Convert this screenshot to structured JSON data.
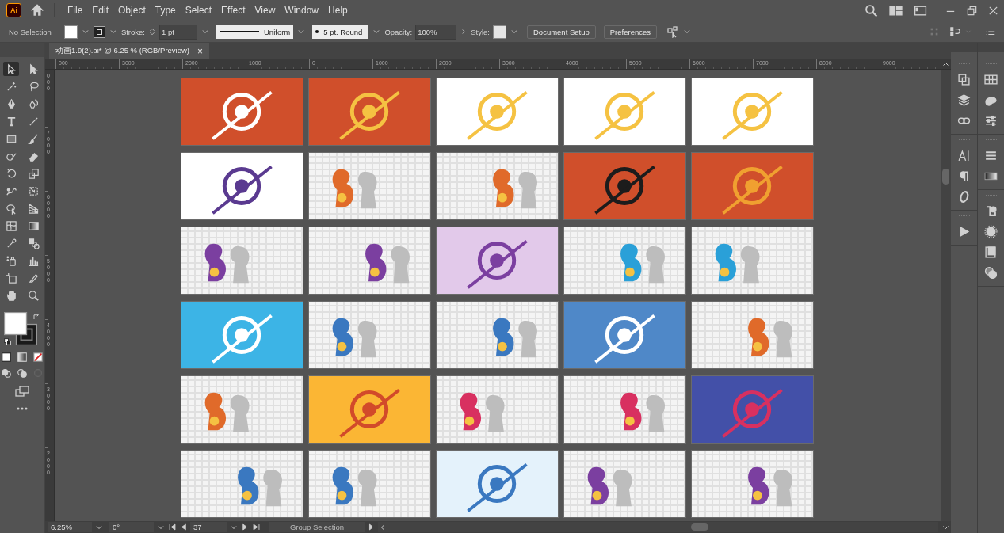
{
  "app_icon": "Ai",
  "menu": [
    "File",
    "Edit",
    "Object",
    "Type",
    "Select",
    "Effect",
    "View",
    "Window",
    "Help"
  ],
  "control_bar": {
    "selection": "No Selection",
    "stroke_label": "Stroke:",
    "stroke_weight": "1 pt",
    "profile": "Uniform",
    "brush": "5 pt. Round",
    "opacity_label": "Opacity:",
    "opacity": "100%",
    "style_label": "Style:",
    "buttons": [
      "Document Setup",
      "Preferences"
    ]
  },
  "document_tab": {
    "title": "动画1.9(2).ai* @ 6.25 % (RGB/Preview)",
    "close": "×"
  },
  "ruler_h": [
    "000",
    "3000",
    "2000",
    "1000",
    "0",
    "1000",
    "2000",
    "3000",
    "4000",
    "5000",
    "6000",
    "7000",
    "8000",
    "9000"
  ],
  "ruler_v": [
    "000",
    "7000",
    "6000",
    "5000",
    "4000",
    "3000",
    "2000"
  ],
  "tools": [
    {
      "selected": true
    },
    {
      "selected": false
    },
    {
      "selected": false
    },
    {
      "selected": false
    },
    {
      "selected": false
    },
    {
      "selected": false
    },
    {
      "selected": false
    },
    {
      "selected": false
    },
    {
      "selected": false
    },
    {
      "selected": false
    },
    {
      "selected": false
    },
    {
      "selected": false
    },
    {
      "selected": false
    },
    {
      "selected": false
    },
    {
      "selected": false
    },
    {
      "selected": false
    },
    {
      "selected": false
    },
    {
      "selected": false
    },
    {
      "selected": false
    },
    {
      "selected": false
    },
    {
      "selected": false
    },
    {
      "selected": false
    },
    {
      "selected": false
    },
    {
      "selected": false
    },
    {
      "selected": false
    },
    {
      "selected": false
    },
    {
      "selected": false
    },
    {
      "selected": false
    }
  ],
  "artboards": [
    {
      "kind": "solid",
      "color": "#d04f2b",
      "artwork": {
        "color": "#ffffff"
      }
    },
    {
      "kind": "solid",
      "color": "#d04f2b",
      "artwork": {
        "color": "#f5c242"
      }
    },
    {
      "kind": "solid",
      "color": "#ffffff",
      "artwork": {
        "color": "#f5c242"
      }
    },
    {
      "kind": "solid",
      "color": "#ffffff",
      "artwork": {
        "color": "#f5c242"
      }
    },
    {
      "kind": "solid",
      "color": "#ffffff",
      "artwork": {
        "color": "#f5c242"
      }
    },
    {
      "kind": "solid",
      "color": "#ffffff",
      "artwork": {
        "color": "#5a3a90"
      }
    },
    {
      "kind": "pattern",
      "color": "#f4f4f4",
      "artwork": {
        "color": "#e06a2a"
      }
    },
    {
      "kind": "pattern",
      "color": "#f4f4f4",
      "artwork": {
        "color": "#e06a2a"
      }
    },
    {
      "kind": "solid",
      "color": "#d04f2b",
      "artwork": {
        "color": "#1c1c1c"
      }
    },
    {
      "kind": "solid",
      "color": "#d04f2b",
      "artwork": {
        "color": "#f0a030"
      }
    },
    {
      "kind": "pattern",
      "color": "#f4f4f4",
      "artwork": {
        "color": "#7b3fa0"
      }
    },
    {
      "kind": "pattern",
      "color": "#f4f4f4",
      "artwork": {
        "color": "#7b3fa0"
      }
    },
    {
      "kind": "solid",
      "color": "#e2c9ea",
      "artwork": {
        "color": "#7b3fa0"
      }
    },
    {
      "kind": "pattern",
      "color": "#f4f4f4",
      "artwork": {
        "color": "#2aa0d8"
      }
    },
    {
      "kind": "pattern",
      "color": "#f4f4f4",
      "artwork": {
        "color": "#2aa0d8"
      }
    },
    {
      "kind": "solid",
      "color": "#3cb4e6",
      "artwork": {
        "color": "#ffffff"
      }
    },
    {
      "kind": "pattern",
      "color": "#f4f4f4",
      "artwork": {
        "color": "#3a78c0"
      }
    },
    {
      "kind": "pattern",
      "color": "#f4f4f4",
      "artwork": {
        "color": "#3a78c0"
      }
    },
    {
      "kind": "solid",
      "color": "#4f88c8",
      "artwork": {
        "color": "#ffffff"
      }
    },
    {
      "kind": "pattern",
      "color": "#f4f4f4",
      "artwork": {
        "color": "#e06a2a"
      }
    },
    {
      "kind": "pattern",
      "color": "#f4f4f4",
      "artwork": {
        "color": "#e06a2a"
      }
    },
    {
      "kind": "solid",
      "color": "#fbb634",
      "artwork": {
        "color": "#d24a2a"
      }
    },
    {
      "kind": "pattern",
      "color": "#f4f4f4",
      "artwork": {
        "color": "#d83060"
      }
    },
    {
      "kind": "pattern",
      "color": "#f4f4f4",
      "artwork": {
        "color": "#d83060"
      }
    },
    {
      "kind": "solid",
      "color": "#4350a8",
      "artwork": {
        "color": "#d83060"
      }
    },
    {
      "kind": "pattern",
      "color": "#f4f4f4",
      "artwork": {
        "color": "#3a78c0"
      }
    },
    {
      "kind": "pattern",
      "color": "#f4f4f4",
      "artwork": {
        "color": "#3a78c0"
      }
    },
    {
      "kind": "solid",
      "color": "#e4f2fb",
      "artwork": {
        "color": "#3a78c0"
      }
    },
    {
      "kind": "pattern",
      "color": "#f4f4f4",
      "artwork": {
        "color": "#7b3fa0"
      }
    },
    {
      "kind": "pattern",
      "color": "#f4f4f4",
      "artwork": {
        "color": "#7b3fa0"
      }
    }
  ],
  "status_bar": {
    "zoom": "6.25%",
    "rotation": "0°",
    "artboard": "37",
    "tool": "Group Selection"
  }
}
